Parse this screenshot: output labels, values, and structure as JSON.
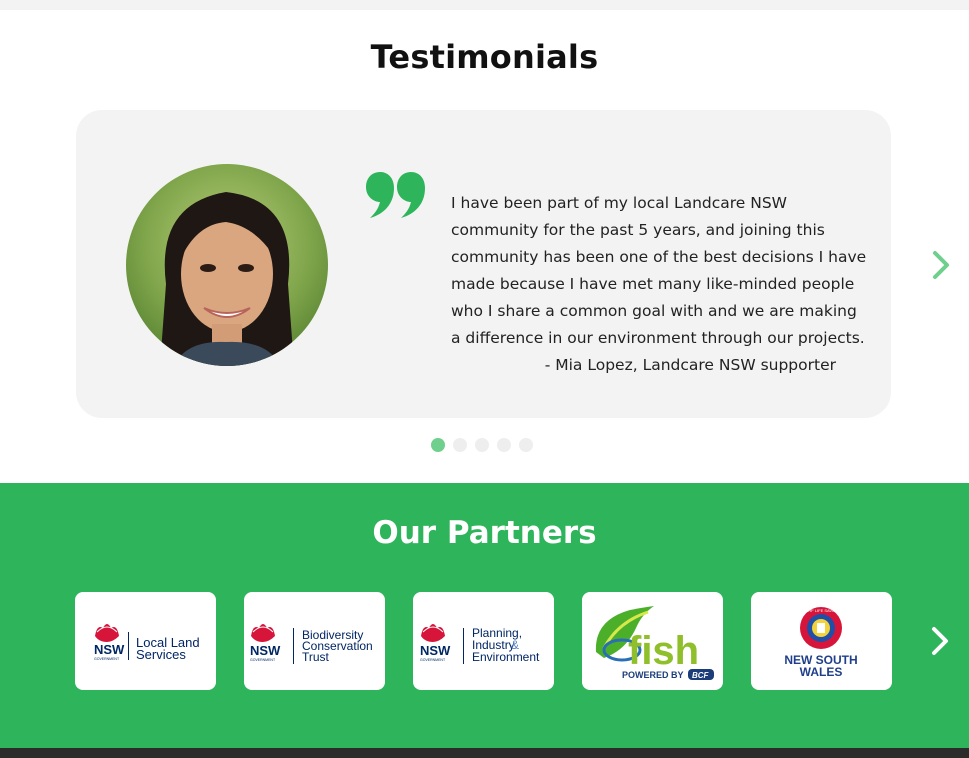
{
  "testimonials": {
    "title": "Testimonials",
    "quote": "I have been part of my local Landcare NSW community for the past 5 years, and joining this community has been one of the best decisions I have made because I have met many like-minded people who I share a common goal with and we are making a difference in our environment through our projects.",
    "author": "- Mia Lopez, Landcare NSW supporter",
    "slide_count": 5,
    "active_slide": 1,
    "quote_color": "#2eb45a",
    "arrow_color": "#6fcf8c"
  },
  "partners": {
    "title": "Our Partners",
    "background": "#2eb45a",
    "logos": [
      {
        "name": "local-land-services",
        "line1": "Local Land",
        "line2": "Services",
        "nsw": "NSW",
        "gov": "GOVERNMENT"
      },
      {
        "name": "biodiversity-conservation-trust",
        "line1": "Biodiversity",
        "line2": "Conservation",
        "line3": "Trust",
        "nsw": "NSW",
        "gov": "GOVERNMENT"
      },
      {
        "name": "planning-industry-environment",
        "line1": "Planning,",
        "line2": "Industry",
        "amp": "&",
        "line3": "Environment",
        "nsw": "NSW",
        "gov": "GOVERNMENT"
      },
      {
        "name": "ofish",
        "text": "fish",
        "sub": "POWERED BY",
        "badge": "BCF"
      },
      {
        "name": "surf-life-saving-nsw",
        "ring": "SURF LIFE SAVING",
        "line1": "NEW SOUTH",
        "line2": "WALES"
      }
    ]
  }
}
